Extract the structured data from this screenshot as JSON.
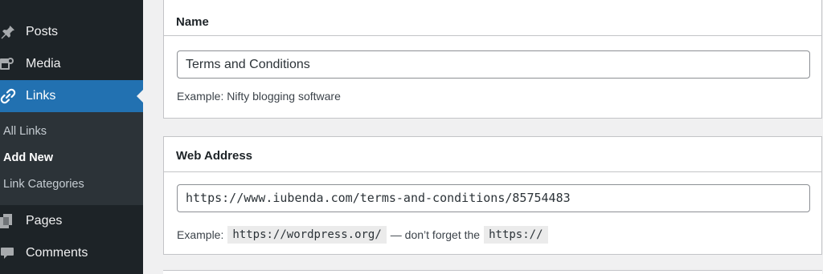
{
  "sidebar": {
    "items": [
      {
        "label": "Posts",
        "icon": "pin-icon"
      },
      {
        "label": "Media",
        "icon": "media-icon"
      },
      {
        "label": "Links",
        "icon": "link-icon"
      },
      {
        "label": "Pages",
        "icon": "pages-icon"
      },
      {
        "label": "Comments",
        "icon": "comment-icon"
      }
    ],
    "submenu": [
      "All Links",
      "Add New",
      "Link Categories"
    ],
    "active_color": "#2271b1",
    "bg_color": "#1d2327"
  },
  "name_box": {
    "title": "Name",
    "value": "Terms and Conditions",
    "help": "Example: Nifty blogging software"
  },
  "url_box": {
    "title": "Web Address",
    "value": "https://www.iubenda.com/terms-and-conditions/85754483",
    "help_prefix": "Example:",
    "help_code1": "https://wordpress.org/",
    "help_middle": "— don’t forget the",
    "help_code2": "https://"
  }
}
